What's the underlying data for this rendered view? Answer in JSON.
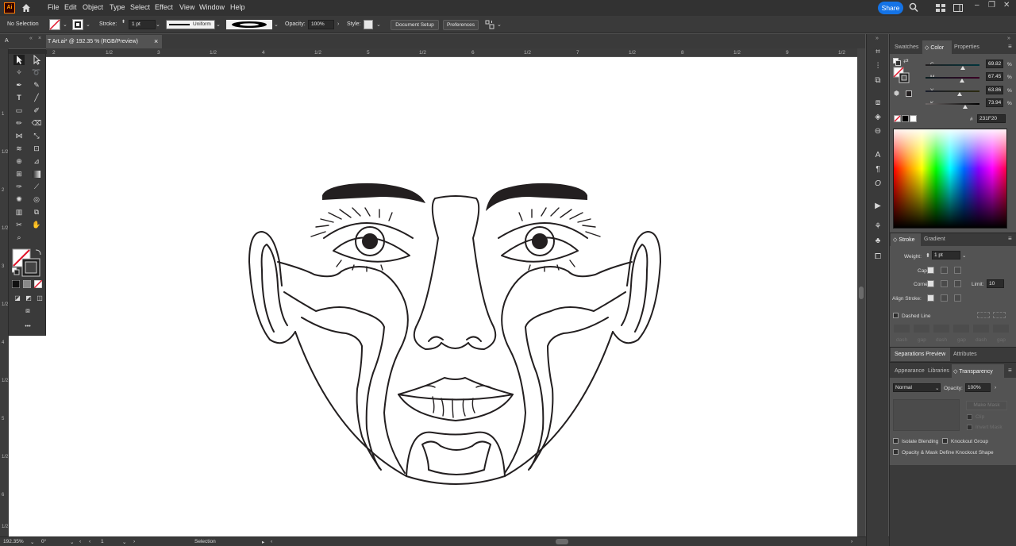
{
  "menubar": {
    "app_logo": "Ai",
    "menus": [
      "File",
      "Edit",
      "Object",
      "Type",
      "Select",
      "Effect",
      "View",
      "Window",
      "Help"
    ],
    "share_label": "Share",
    "icons": [
      "home-icon",
      "search-icon",
      "arrange-documents-icon",
      "workspace-icon"
    ]
  },
  "control_bar": {
    "selection_status": "No Selection",
    "stroke_label": "Stroke:",
    "stroke_weight": "1 pt",
    "stroke_profile": "Uniform",
    "opacity_label": "Opacity:",
    "opacity_value": "100%",
    "style_label": "Style:",
    "document_setup": "Document Setup",
    "preferences": "Preferences"
  },
  "document_tab": {
    "title": "T Art.ai* @ 192.35 % (RGB/Preview)",
    "close": "×",
    "left_fragment": "A"
  },
  "ruler": {
    "h_labels": [
      "2",
      "1/2",
      "3",
      "1/2",
      "4",
      "1/2",
      "5",
      "1/2",
      "6",
      "1/2",
      "7",
      "1/2",
      "8",
      "1/2",
      "9",
      "1/2"
    ],
    "v_labels": [
      "1",
      "1/2",
      "2",
      "1/2",
      "3",
      "1/2",
      "4",
      "1/2",
      "5",
      "1/2",
      "6",
      "1/2"
    ]
  },
  "toolbar": {
    "more_tools": "•••"
  },
  "statusbar": {
    "zoom": "192.35%",
    "rotation": "0°",
    "artboard": "1",
    "tool": "Selection"
  },
  "color_panel": {
    "tabs": [
      "Swatches",
      "Color",
      "Properties"
    ],
    "active_tab": "Color",
    "channels": [
      {
        "label": "C",
        "value": "69.82",
        "unit": "%",
        "level": 0.698
      },
      {
        "label": "M",
        "value": "67.45",
        "unit": "%",
        "level": 0.675
      },
      {
        "label": "Y",
        "value": "63.86",
        "unit": "%",
        "level": 0.639
      },
      {
        "label": "K",
        "value": "73.94",
        "unit": "%",
        "level": 0.739
      }
    ],
    "hex_symbol": "#",
    "hex_value": "231F20"
  },
  "stroke_panel": {
    "tabs": [
      "Stroke",
      "Gradient"
    ],
    "weight_label": "Weight:",
    "weight_value": "1 pt",
    "cap_label": "Cap:",
    "corner_label": "Corner:",
    "limit_label": "Limit:",
    "limit_value": "10",
    "align_label": "Align Stroke:",
    "dashed_line": "Dashed Line",
    "dash_labels": [
      "dash",
      "gap",
      "dash",
      "gap",
      "dash",
      "gap"
    ]
  },
  "separations_panel": {
    "tabs": [
      "Separations Preview",
      "Attributes"
    ]
  },
  "transparency_panel": {
    "tabs": [
      "Appearance",
      "Libraries",
      "Transparency"
    ],
    "blend_mode": "Normal",
    "opacity_label": "Opacity:",
    "opacity_value": "100%",
    "make_mask": "Make Mask",
    "clip": "Clip",
    "invert_mask": "Invert Mask",
    "isolate_blending": "Isolate Blending",
    "knockout_group": "Knockout Group",
    "opacity_mask_knockout": "Opacity & Mask Define Knockout Shape"
  },
  "colors": {
    "ui_dark": "#323232",
    "ui_panel": "#3a3a3a",
    "pasteboard": "#535353",
    "accent_blue": "#1473e6",
    "ai_orange": "#ff9a00",
    "artwork_stroke": "#231f20"
  }
}
